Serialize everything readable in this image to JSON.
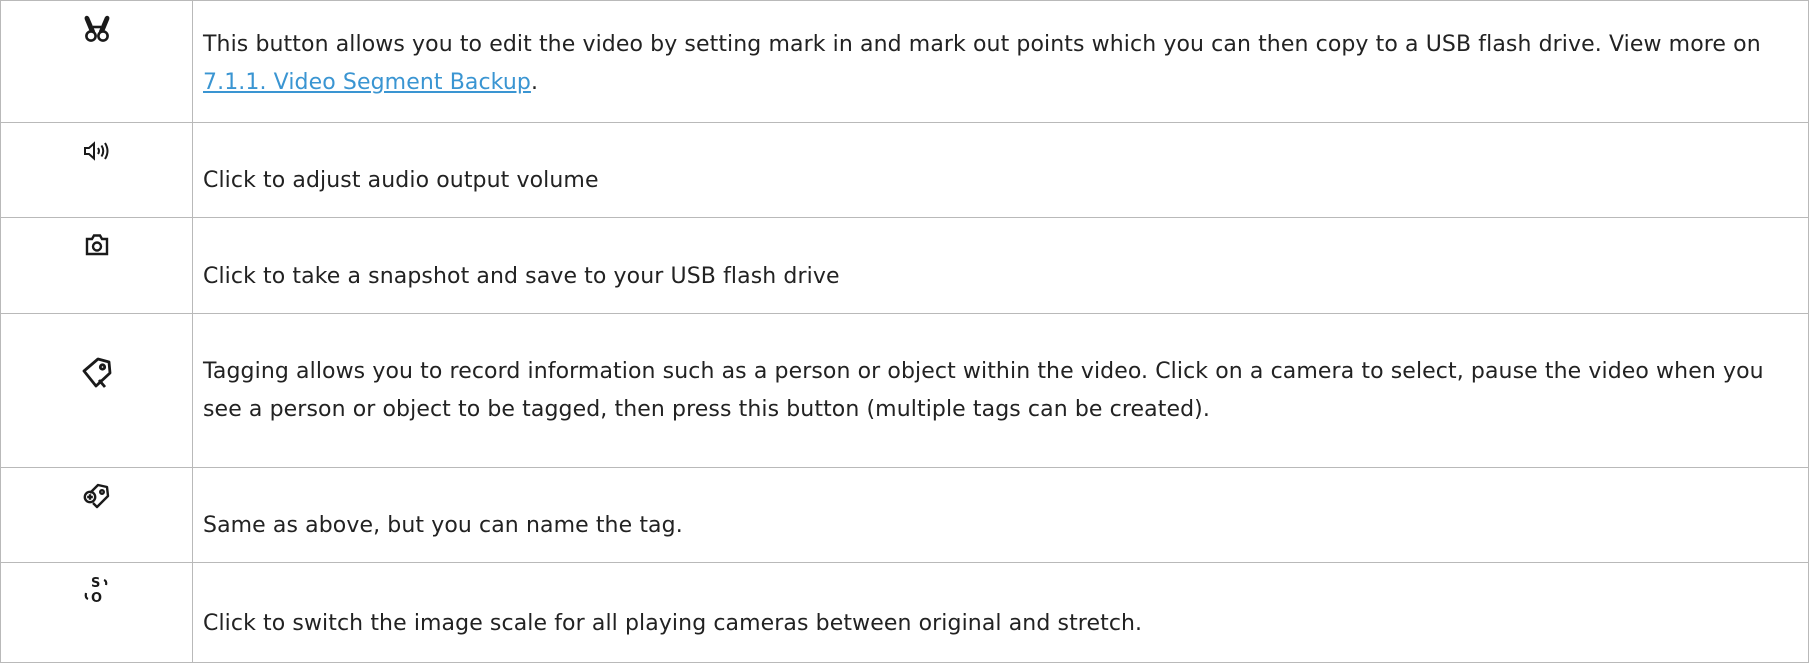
{
  "rows": [
    {
      "icon": "scissors-icon",
      "text_before": "This button allows you to edit the video by setting mark in and mark out points which you can then copy to a USB flash drive. View more on ",
      "link": "7.1.1. Video Segment Backup",
      "text_after": "."
    },
    {
      "icon": "speaker-volume-icon",
      "text": "Click to adjust audio output volume"
    },
    {
      "icon": "camera-icon",
      "text": "Click to take a snapshot and save to your USB flash drive"
    },
    {
      "icon": "tag-icon",
      "text": "Tagging allows you to record information such as a person or object within the video. Click on a camera to select, pause the video when you see a person or object to be tagged, then press this button (multiple tags can be created)."
    },
    {
      "icon": "add-tag-icon",
      "text": "Same as above, but you can name the tag."
    },
    {
      "icon": "image-scale-icon",
      "text": "Click to switch the image scale for all playing cameras between original and stretch."
    }
  ],
  "colors": {
    "link": "#3a95d2",
    "border": "#b9b9b9",
    "text": "#222222"
  }
}
